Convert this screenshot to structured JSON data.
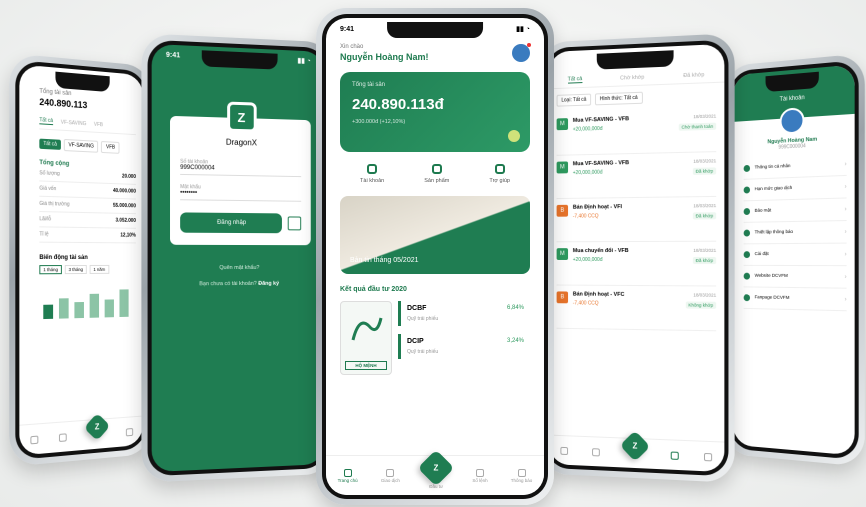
{
  "p1": {
    "label": "Tổng tài sản",
    "balance": "240.890.113",
    "tabs": [
      "Tất cả",
      "VF-SAVING",
      "VFB"
    ],
    "section": "Tổng cộng",
    "rows": [
      {
        "k": "Số lượng",
        "v": "20.000"
      },
      {
        "k": "Giá vốn",
        "v": "40.000.000"
      },
      {
        "k": "Giá thị trường",
        "v": "55.000.000"
      },
      {
        "k": "Lãi/lỗ",
        "v": "3.052.000"
      },
      {
        "k": "Tỉ lệ",
        "v": "12,10%"
      }
    ],
    "chart_title": "Biến động tài sản",
    "chart_tabs": [
      "1 tháng",
      "3 tháng",
      "1 năm"
    ]
  },
  "p2": {
    "time": "9:41",
    "logo_text": "Z",
    "brand": "DragonX",
    "account_label": "Số tài khoản",
    "account_value": "999C000004",
    "password_label": "Mật khẩu",
    "password_value": "••••••••",
    "login_button": "Đăng nhập",
    "forgot": "Quên mật khẩu?",
    "register_prefix": "Bạn chưa có tài khoản?",
    "register_link": "Đăng ký"
  },
  "p3": {
    "time": "9:41",
    "greeting": "Xin chào",
    "name": "Nguyễn Hoàng Nam!",
    "asset_label": "Tổng tài sản",
    "asset_value": "240.890.113đ",
    "asset_change": "+300.000đ (+12,10%)",
    "actions": [
      {
        "label": "Tài khoản"
      },
      {
        "label": "Sản phẩm"
      },
      {
        "label": "Trợ giúp"
      }
    ],
    "banner_title": "Bản tin tháng 05/2021",
    "section_title": "Kết quả đầu tư 2020",
    "seal_text": "HỘ MỆNH",
    "funds": [
      {
        "name": "DCBF",
        "sub": "Quỹ trái phiếu",
        "pct": "6,84%"
      },
      {
        "name": "DCIP",
        "sub": "Quỹ trái phiếu",
        "pct": "3,24%"
      }
    ],
    "nav": [
      "Trang chủ",
      "Giao dịch",
      "Đầu tư",
      "Sổ lệnh",
      "Thông báo"
    ]
  },
  "p4": {
    "tabs": [
      "Tất cả",
      "Chờ khớp",
      "Đã khớp"
    ],
    "filters": [
      "Loại: Tất cả",
      "Hình thức: Tất cả"
    ],
    "orders": [
      {
        "type": "M",
        "title": "Mua VF-SAVING - VFB",
        "amount": "+20,000,000đ",
        "date": "18/03/2021",
        "status": "Chờ thanh toán",
        "color": "#2e9a5f"
      },
      {
        "type": "M",
        "title": "Mua VF-SAVING - VFB",
        "amount": "+20,000,000đ",
        "date": "18/03/2021",
        "status": "Đã khớp",
        "color": "#2e9a5f"
      },
      {
        "type": "B",
        "title": "Bán Định hoạt - VFI",
        "amount": "-7,400 CCQ",
        "date": "18/03/2021",
        "status": "Đã khớp",
        "color": "#e8742b"
      },
      {
        "type": "M",
        "title": "Mua chuyển đổi - VFB",
        "amount": "+20,000,000đ",
        "date": "18/03/2021",
        "status": "Đã khớp",
        "color": "#2e9a5f"
      },
      {
        "type": "B",
        "title": "Bán Định hoạt - VFC",
        "amount": "-7,400 CCQ",
        "date": "18/03/2021",
        "status": "Không khớp",
        "color": "#e8742b"
      }
    ]
  },
  "p5": {
    "title": "Tài khoản",
    "name": "Nguyễn Hoàng Nam",
    "id": "999C000004",
    "menu": [
      "Thông tin cá nhân",
      "Hạn mức giao dịch",
      "Bảo mật",
      "Thiết lập thông báo",
      "Cài đặt",
      "Website DCVFM",
      "Fanpage DCVFM"
    ]
  }
}
